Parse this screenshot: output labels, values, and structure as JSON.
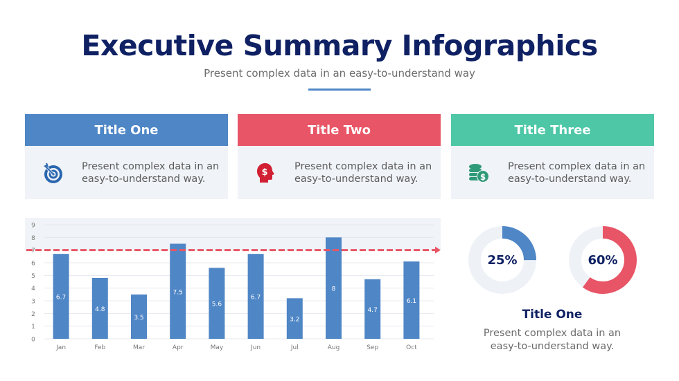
{
  "header": {
    "title": "Executive Summary Infographics",
    "subtitle": "Present complex data in an easy-to-understand way"
  },
  "colors": {
    "navy": "#0f2163",
    "blue": "#4f86c6",
    "red": "#e85566",
    "green": "#4ec7a6",
    "card_bg": "#f0f3f7"
  },
  "cards": [
    {
      "title": "Title One",
      "icon": "target-icon",
      "text_line1": "Present complex data in an",
      "text_line2": "easy-to-understand way."
    },
    {
      "title": "Title Two",
      "icon": "head-dollar-icon",
      "text_line1": "Present complex data in an",
      "text_line2": "easy-to-understand way."
    },
    {
      "title": "Title Three",
      "icon": "coins-dollar-icon",
      "text_line1": "Present complex data in an",
      "text_line2": "easy-to-understand way."
    }
  ],
  "chart_data": {
    "type": "bar",
    "title": "",
    "xlabel": "",
    "ylabel": "",
    "categories": [
      "Jan",
      "Feb",
      "Mar",
      "Apr",
      "May",
      "Jun",
      "Jul",
      "Aug",
      "Sep",
      "Oct"
    ],
    "values": [
      6.7,
      4.8,
      3.5,
      7.5,
      5.6,
      6.7,
      3.2,
      8,
      4.7,
      6.1
    ],
    "data_labels": [
      "6.7",
      "4.8",
      "3.5",
      "7.5",
      "5.6",
      "6.7",
      "3.2",
      "8",
      "4.7",
      "6.1"
    ],
    "ylim": [
      0,
      9
    ],
    "yticks": [
      0,
      1,
      2,
      3,
      4,
      5,
      6,
      7,
      8,
      9
    ],
    "grid": true,
    "target_line": {
      "value": 7,
      "style": "dashed",
      "color": "#e85566"
    },
    "bar_color": "#4f86c6"
  },
  "donuts": [
    {
      "label": "25%",
      "value": 25,
      "color": "#4f86c6"
    },
    {
      "label": "60%",
      "value": 60,
      "color": "#e85566"
    }
  ],
  "right_panel": {
    "title": "Title One",
    "text_line1": "Present complex data in an",
    "text_line2": "easy-to-understand way."
  }
}
